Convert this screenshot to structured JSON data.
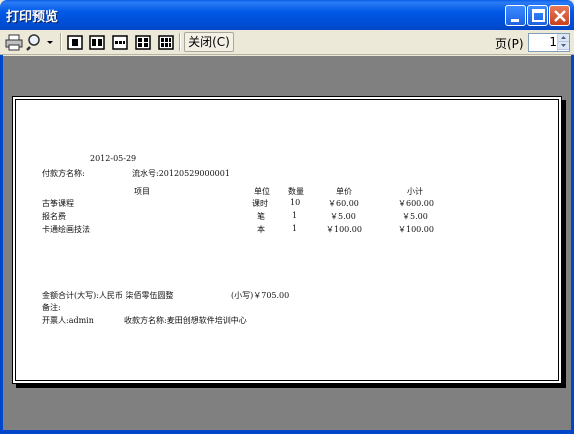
{
  "window": {
    "title": "打印预览"
  },
  "toolbar": {
    "close_label": "关闭(C)",
    "page_label": "页(P)",
    "page_value": "1",
    "icons": [
      "printer-icon",
      "zoom-icon",
      "dropdown-arrow-icon",
      "one-page-icon",
      "two-page-icon",
      "three-page-icon",
      "four-page-icon",
      "six-page-icon"
    ]
  },
  "document": {
    "date": "2012-05-29",
    "payer_label": "付款方名称:",
    "serial": "流水号:20120529000001",
    "headers": {
      "item": "项目",
      "unit": "单位",
      "qty": "数量",
      "price": "单价",
      "subtotal": "小计"
    },
    "rows": [
      {
        "item": "古筝课程",
        "unit": "课时",
        "qty": "10",
        "price": "￥60.00",
        "subtotal": "￥600.00"
      },
      {
        "item": "报名费",
        "unit": "笔",
        "qty": "1",
        "price": "￥5.00",
        "subtotal": "￥5.00"
      },
      {
        "item": "卡通绘画技法",
        "unit": "本",
        "qty": "1",
        "price": "￥100.00",
        "subtotal": "￥100.00"
      }
    ],
    "total_line": "金额合计(大写):人民币 柒佰零伍圆整",
    "total_small": "(小写)￥705.00",
    "remark_label": "备注:",
    "issuer": "开票人:admin",
    "receiver": "收款方名称:麦田创想软件培训中心"
  },
  "colors": {
    "titlebar": "#0054e3",
    "preview_bg": "#808080",
    "close_button": "#d8552f"
  }
}
